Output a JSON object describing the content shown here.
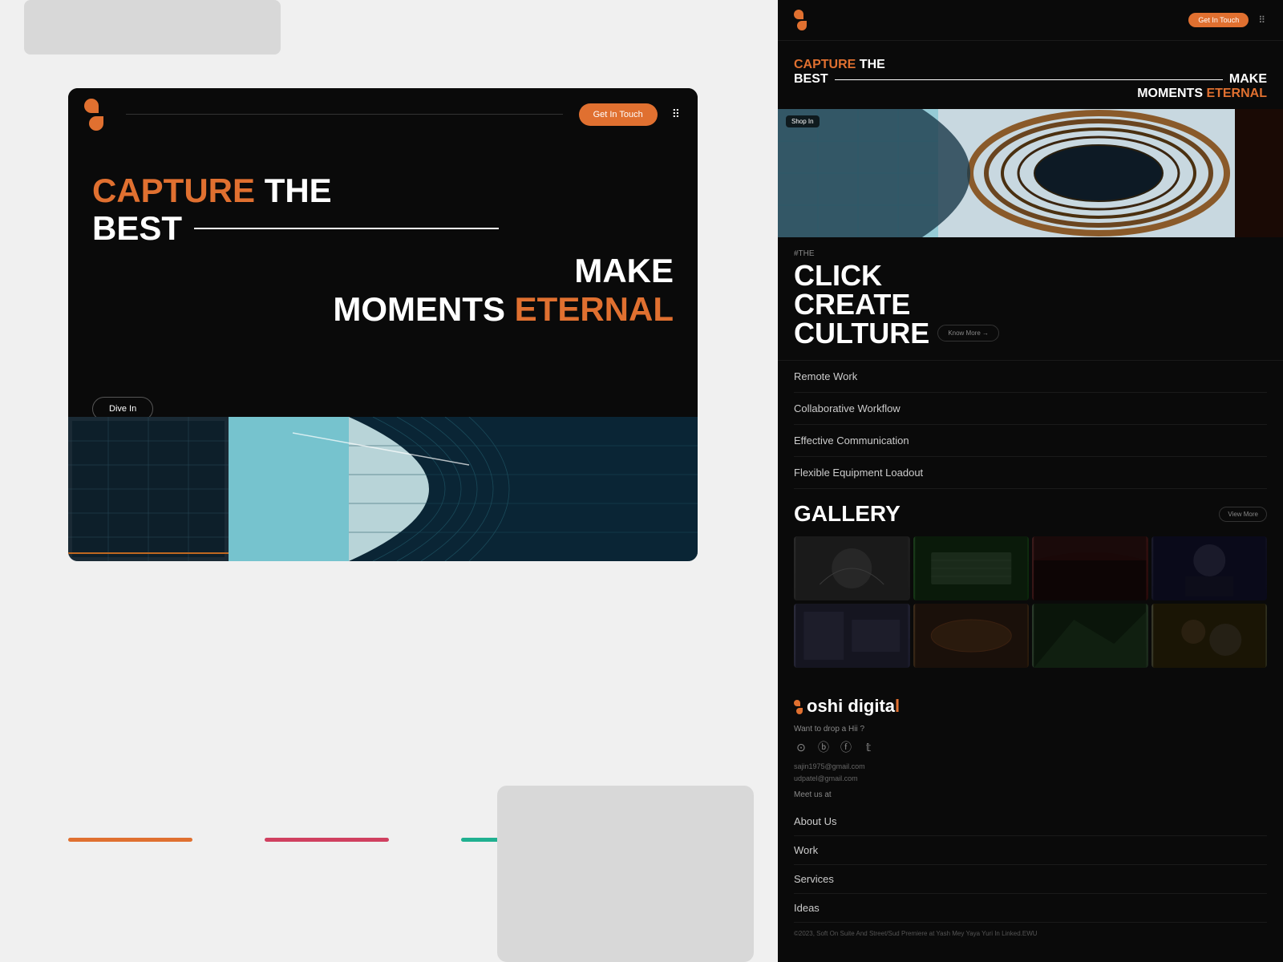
{
  "left": {
    "header": {
      "get_in_touch": "Get In Touch",
      "hero": {
        "capture": "CAPTURE",
        "the_best": "THE BEST",
        "make": "MAKE",
        "moments": "MOMENTS",
        "eternal": "ETERNAL"
      },
      "dive_in": "Dive In"
    },
    "color_bars": [
      "orange",
      "pink",
      "teal"
    ]
  },
  "right": {
    "header": {
      "cta_label": "Get In Touch"
    },
    "hero": {
      "capture": "CAPTURE",
      "the": "THE",
      "best": "BEST",
      "make": "MAKE",
      "moments": "MOMENTS",
      "eternal": "ETERNAL"
    },
    "arch_badge": "Shop In",
    "ccc": {
      "tag": "#THE",
      "title_line1": "CLICK",
      "title_line2": "CREATE",
      "title_line3": "CULTURE",
      "know_more": "Know More →"
    },
    "features": [
      "Remote Work",
      "Collaborative Workflow",
      "Effective Communication",
      "Flexible Equipment Loadout"
    ],
    "gallery": {
      "title": "GALLERY",
      "view_more": "View More"
    },
    "footer": {
      "brand": "oshi digital",
      "want_hi": "Want to drop a Hii ?",
      "email1": "sajin1975@gmail.com",
      "email2": "udpatel@gmail.com",
      "meet_us": "Meet us at",
      "nav_items": [
        "About Us",
        "Work",
        "Services",
        "Ideas"
      ],
      "address": "©2023, Soft On Suite And Street/Sud Premiere at Yash Mey Yaya Yuri In Linked.EWU"
    }
  }
}
